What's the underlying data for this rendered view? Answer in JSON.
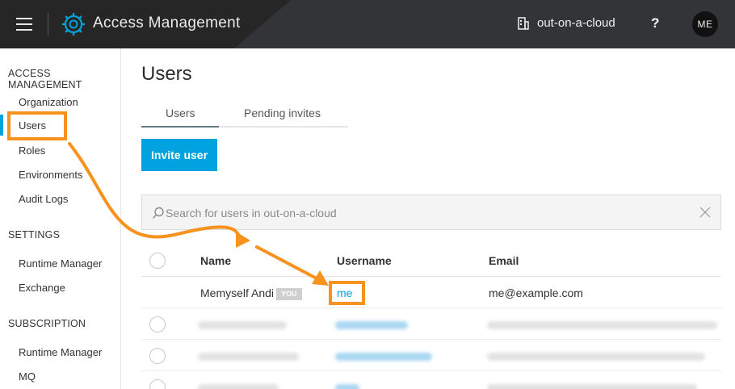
{
  "app": {
    "title": "Access Management",
    "org_name": "out-on-a-cloud",
    "help_label": "?",
    "avatar_initials": "ME",
    "accent_color": "#00a2df",
    "annotation_color": "#f7921e"
  },
  "sidebar": {
    "sections": [
      {
        "heading": "ACCESS MANAGEMENT",
        "items": [
          "Organization",
          "Users",
          "Roles",
          "Environments",
          "Audit Logs"
        ]
      },
      {
        "heading": "SETTINGS",
        "items": [
          "Runtime Manager",
          "Exchange"
        ]
      },
      {
        "heading": "SUBSCRIPTION",
        "items": [
          "Runtime Manager",
          "MQ"
        ]
      }
    ],
    "active_item": "Users"
  },
  "main": {
    "page_title": "Users",
    "tabs": [
      {
        "label": "Users",
        "active": true
      },
      {
        "label": "Pending invites",
        "active": false
      }
    ],
    "invite_button_label": "Invite user",
    "search": {
      "placeholder": "Search for users in out-on-a-cloud",
      "value": ""
    },
    "table": {
      "columns": [
        "Name",
        "Username",
        "Email"
      ],
      "rows": [
        {
          "name": "Memyself Andi",
          "badge": "YOU",
          "username": "me",
          "email": "me@example.com",
          "redacted": false
        },
        {
          "redacted": true
        },
        {
          "redacted": true
        },
        {
          "redacted": true
        }
      ]
    }
  },
  "icons": {
    "menu": "hamburger-menu-icon",
    "logo": "gear-logo-icon",
    "org": "building-icon",
    "search": "search-icon",
    "clear": "close-icon"
  }
}
